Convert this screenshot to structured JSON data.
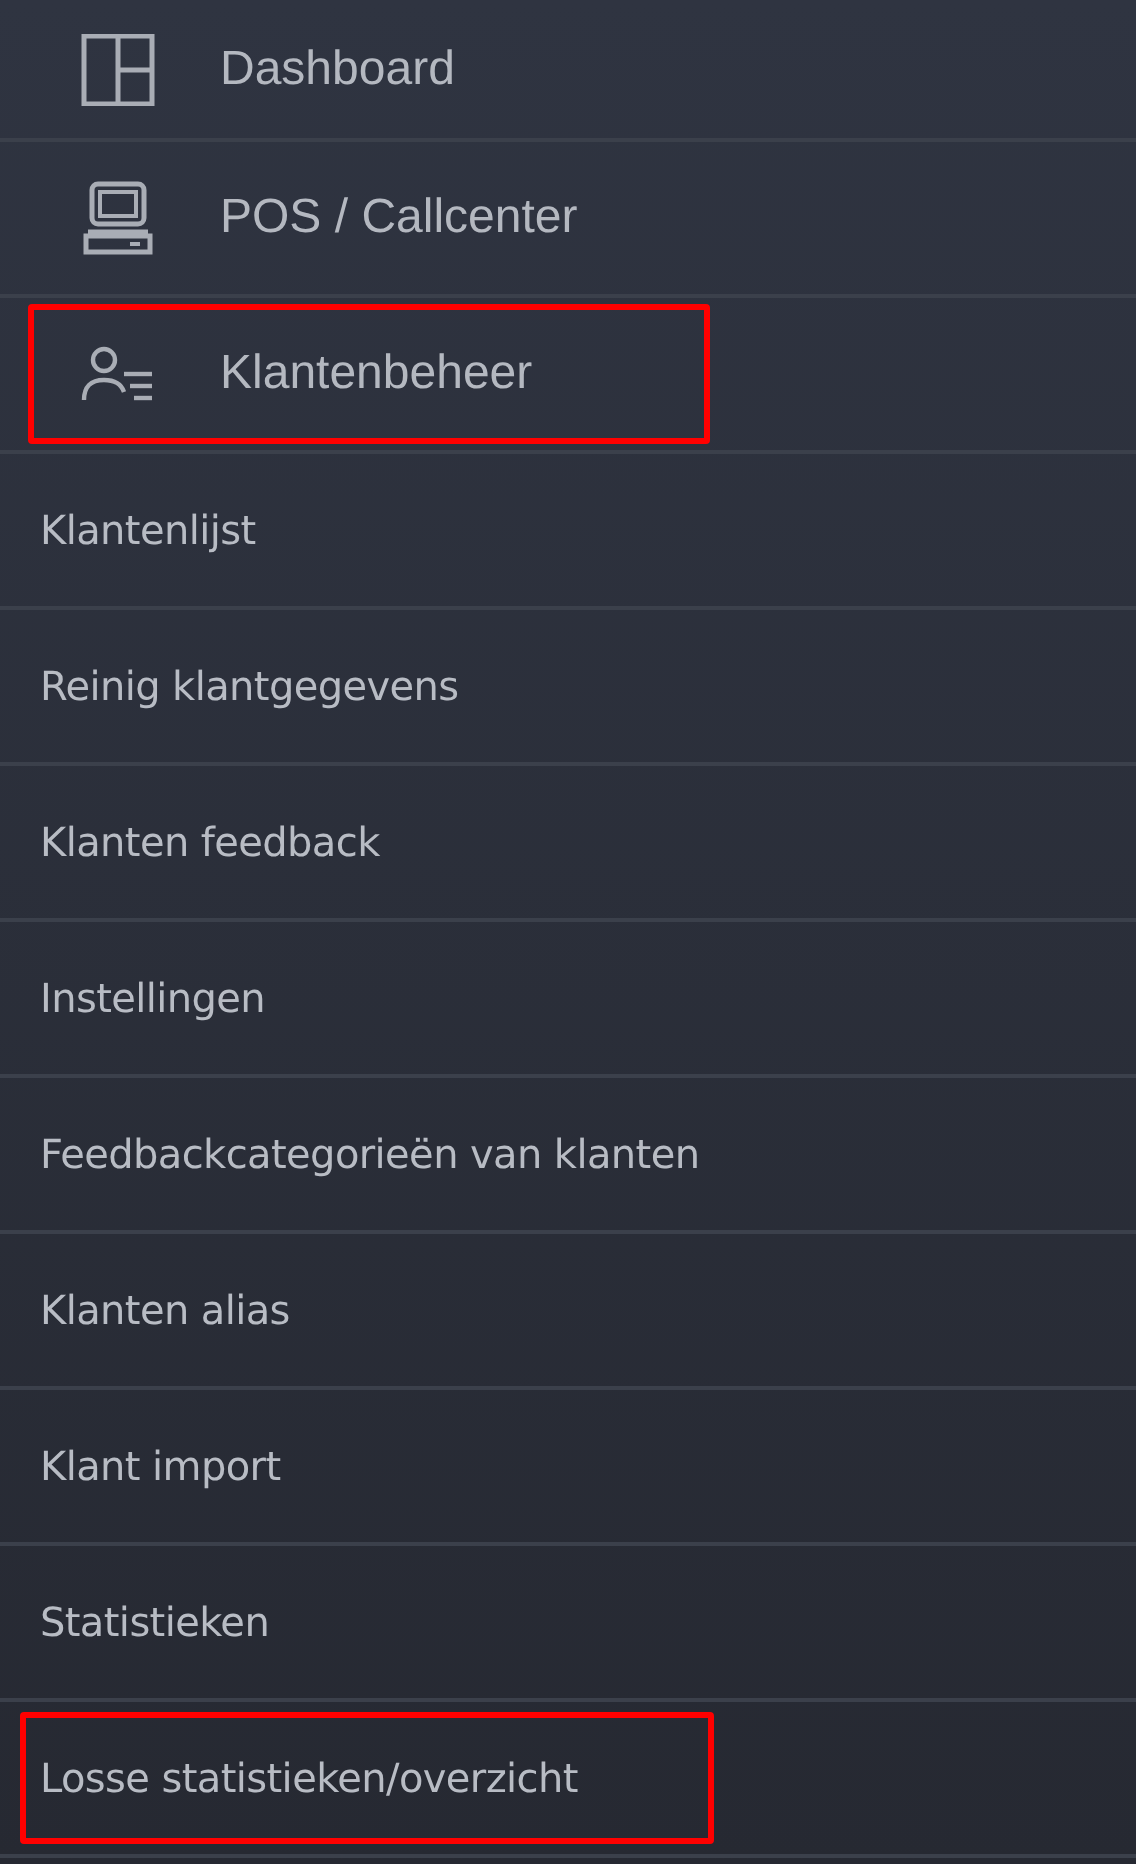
{
  "menu": [
    {
      "kind": "main",
      "label": "Dashboard",
      "highlighted": false
    },
    {
      "kind": "main",
      "label": "POS / Callcenter",
      "highlighted": false
    },
    {
      "kind": "main",
      "label": "Klantenbeheer",
      "highlighted": true
    },
    {
      "kind": "sub",
      "label": "Klantenlijst",
      "highlighted": false
    },
    {
      "kind": "sub",
      "label": "Reinig klantgegevens",
      "highlighted": false
    },
    {
      "kind": "sub",
      "label": "Klanten feedback",
      "highlighted": false
    },
    {
      "kind": "sub",
      "label": "Instellingen",
      "highlighted": false
    },
    {
      "kind": "sub",
      "label": "Feedbackcategorieën van klanten",
      "highlighted": false
    },
    {
      "kind": "sub",
      "label": "Klanten alias",
      "highlighted": false
    },
    {
      "kind": "sub",
      "label": "Klant import",
      "highlighted": false
    },
    {
      "kind": "sub",
      "label": "Statistieken",
      "highlighted": false
    },
    {
      "kind": "sub",
      "label": "Losse statistieken/overzicht",
      "highlighted": true
    }
  ]
}
